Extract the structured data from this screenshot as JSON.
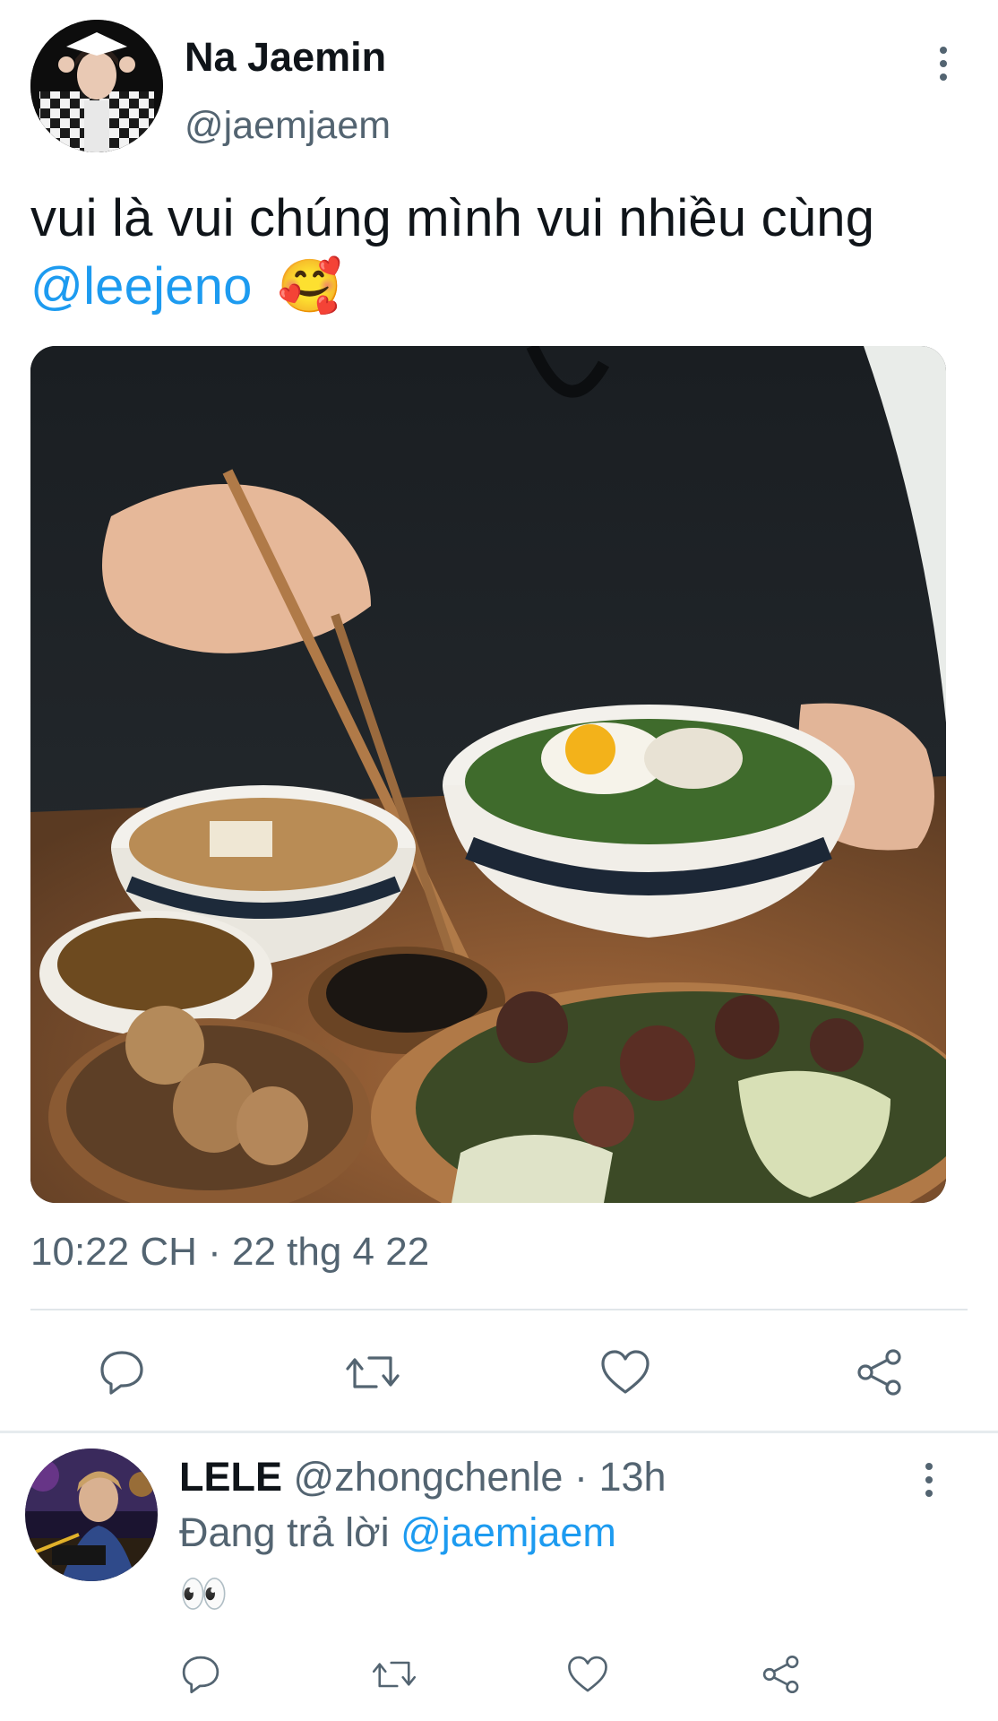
{
  "tweet": {
    "author_name": "Na Jaemin",
    "author_handle": "@jaemjaem",
    "text_line1": "vui là vui chúng mình vui nhiều cùng",
    "mention": "@leejeno",
    "emoji": "🥰",
    "timestamp": "10:22 CH · 22 thg 4 22"
  },
  "reply": {
    "author_name": "LELE",
    "author_handle": "@zhongchenle",
    "time_sep": " · ",
    "time": "13h",
    "replying_label": "Đang trả lời",
    "replying_to": "@jaemjaem",
    "text": "👀"
  },
  "icons": {
    "reply": "reply-icon",
    "retweet": "retweet-icon",
    "like": "heart-icon",
    "share": "share-icon",
    "more": "more-vertical-icon"
  },
  "colors": {
    "accent": "#1d9bf0",
    "secondary_text": "#536471",
    "divider": "#e1e6ea"
  }
}
